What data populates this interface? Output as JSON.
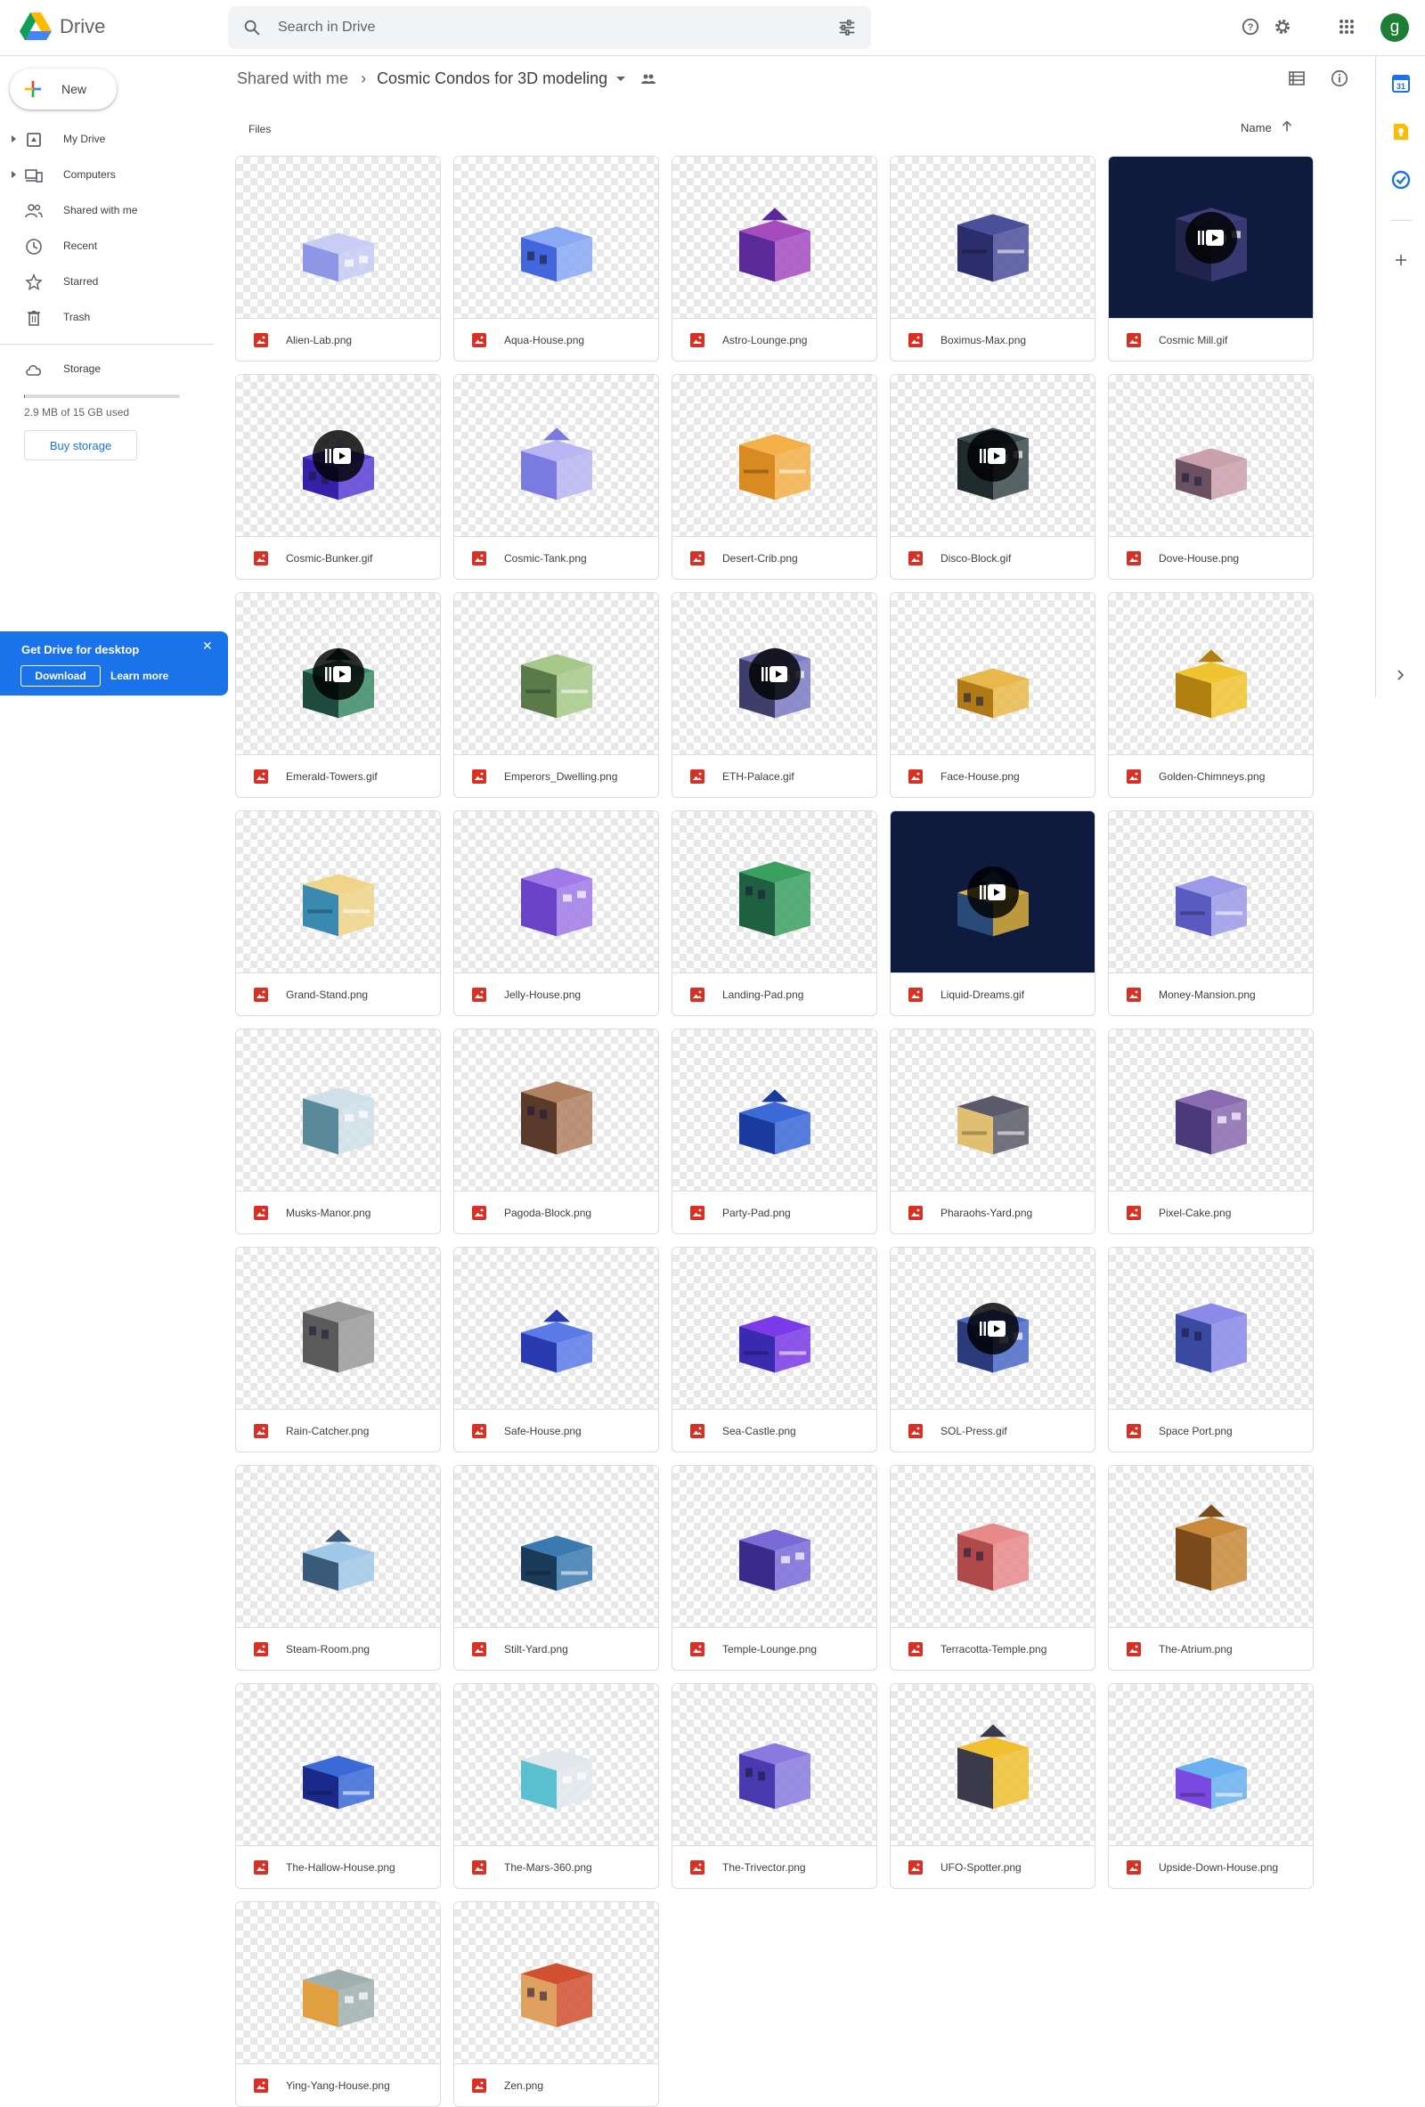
{
  "header": {
    "app_title": "Drive",
    "search_placeholder": "Search in Drive",
    "avatar_initial": "g",
    "icons": [
      "drive-logo",
      "search-icon",
      "tune-icon",
      "help-icon",
      "settings-icon",
      "apps-icon"
    ]
  },
  "sidebar": {
    "new_label": "New",
    "items": [
      {
        "label": "My Drive",
        "icon": "my-drive-icon",
        "expandable": true
      },
      {
        "label": "Computers",
        "icon": "computers-icon",
        "expandable": true
      },
      {
        "label": "Shared with me",
        "icon": "shared-icon",
        "expandable": false
      },
      {
        "label": "Recent",
        "icon": "recent-icon",
        "expandable": false
      },
      {
        "label": "Starred",
        "icon": "star-icon",
        "expandable": false
      },
      {
        "label": "Trash",
        "icon": "trash-icon",
        "expandable": false
      }
    ],
    "storage_label": "Storage",
    "storage_text": "2.9 MB of 15 GB used",
    "storage_fraction": 0.0002,
    "buy_storage_label": "Buy storage"
  },
  "promo": {
    "title": "Get Drive for desktop",
    "download_label": "Download",
    "learn_more_label": "Learn more"
  },
  "main": {
    "breadcrumb": [
      "Shared with me",
      "Cosmic Condos for 3D modeling"
    ],
    "section_label": "Files",
    "sort_label": "Name",
    "files": [
      {
        "name": "Alien-Lab.png",
        "animated": false,
        "dark_bg": false,
        "colors": [
          "#c7cdf5",
          "#8e97e6"
        ]
      },
      {
        "name": "Aqua-House.png",
        "animated": false,
        "dark_bg": false,
        "colors": [
          "#8aa9f4",
          "#4466dd"
        ]
      },
      {
        "name": "Astro-Lounge.png",
        "animated": false,
        "dark_bg": false,
        "colors": [
          "#a44bc0",
          "#5b2a9a"
        ]
      },
      {
        "name": "Boximus-Max.png",
        "animated": false,
        "dark_bg": false,
        "colors": [
          "#4a4f9a",
          "#2b2e6a"
        ]
      },
      {
        "name": "Cosmic Mill.gif",
        "animated": true,
        "dark_bg": true,
        "colors": [
          "#3e3f7a",
          "#22234a"
        ]
      },
      {
        "name": "Cosmic-Bunker.gif",
        "animated": true,
        "dark_bg": false,
        "colors": [
          "#5b3fd6",
          "#3520a8"
        ]
      },
      {
        "name": "Cosmic-Tank.png",
        "animated": false,
        "dark_bg": false,
        "colors": [
          "#b9b5f2",
          "#7b7ae0"
        ]
      },
      {
        "name": "Desert-Crib.png",
        "animated": false,
        "dark_bg": false,
        "colors": [
          "#f5b04a",
          "#d98a20"
        ]
      },
      {
        "name": "Disco-Block.gif",
        "animated": true,
        "dark_bg": false,
        "colors": [
          "#3a4a4c",
          "#1f2b2d"
        ]
      },
      {
        "name": "Dove-House.png",
        "animated": false,
        "dark_bg": false,
        "colors": [
          "#c9a0ac",
          "#6a5060"
        ]
      },
      {
        "name": "Emerald-Towers.gif",
        "animated": true,
        "dark_bg": false,
        "colors": [
          "#3b8b66",
          "#1f4a3e"
        ]
      },
      {
        "name": "Emperors_Dwelling.png",
        "animated": false,
        "dark_bg": false,
        "colors": [
          "#a6c98a",
          "#5a7a4a"
        ]
      },
      {
        "name": "ETH-Palace.gif",
        "animated": true,
        "dark_bg": false,
        "colors": [
          "#7a7ac4",
          "#3e3e6a"
        ]
      },
      {
        "name": "Face-House.png",
        "animated": false,
        "dark_bg": false,
        "colors": [
          "#e9b84a",
          "#b07a18"
        ]
      },
      {
        "name": "Golden-Chimneys.png",
        "animated": false,
        "dark_bg": false,
        "colors": [
          "#f0c430",
          "#b08010"
        ]
      },
      {
        "name": "Grand-Stand.png",
        "animated": false,
        "dark_bg": false,
        "colors": [
          "#f0d48a",
          "#3a8ab0"
        ]
      },
      {
        "name": "Jelly-House.png",
        "animated": false,
        "dark_bg": false,
        "colors": [
          "#a07ae8",
          "#6a44c8"
        ]
      },
      {
        "name": "Landing-Pad.png",
        "animated": false,
        "dark_bg": false,
        "colors": [
          "#3aa060",
          "#1e6040"
        ]
      },
      {
        "name": "Liquid-Dreams.gif",
        "animated": true,
        "dark_bg": true,
        "colors": [
          "#d8b040",
          "#2a4a7a"
        ]
      },
      {
        "name": "Money-Mansion.png",
        "animated": false,
        "dark_bg": false,
        "colors": [
          "#9a9ae8",
          "#5a5ac0"
        ]
      },
      {
        "name": "Musks-Manor.png",
        "animated": false,
        "dark_bg": false,
        "colors": [
          "#cfe0e8",
          "#5a8a9a"
        ]
      },
      {
        "name": "Pagoda-Block.png",
        "animated": false,
        "dark_bg": false,
        "colors": [
          "#b08060",
          "#5a3a2a"
        ]
      },
      {
        "name": "Party-Pad.png",
        "animated": false,
        "dark_bg": false,
        "colors": [
          "#3a6ad8",
          "#1a3aa0"
        ]
      },
      {
        "name": "Pharaohs-Yard.png",
        "animated": false,
        "dark_bg": false,
        "colors": [
          "#5a5a6a",
          "#e0c070"
        ]
      },
      {
        "name": "Pixel-Cake.png",
        "animated": false,
        "dark_bg": false,
        "colors": [
          "#8a6ab0",
          "#4a3a7a"
        ]
      },
      {
        "name": "Rain-Catcher.png",
        "animated": false,
        "dark_bg": false,
        "colors": [
          "#9a9a9a",
          "#5a5a5a"
        ]
      },
      {
        "name": "Safe-House.png",
        "animated": false,
        "dark_bg": false,
        "colors": [
          "#5a7ae8",
          "#2a3ab0"
        ]
      },
      {
        "name": "Sea-Castle.png",
        "animated": false,
        "dark_bg": false,
        "colors": [
          "#7a3ae8",
          "#3a2ab0"
        ]
      },
      {
        "name": "SOL-Press.gif",
        "animated": true,
        "dark_bg": false,
        "colors": [
          "#4a6ac8",
          "#2a3a7a"
        ]
      },
      {
        "name": "Space Port.png",
        "animated": false,
        "dark_bg": false,
        "colors": [
          "#8a8ae8",
          "#3a4aa0"
        ]
      },
      {
        "name": "Steam-Room.png",
        "animated": false,
        "dark_bg": false,
        "colors": [
          "#a0c8e8",
          "#3a5a7a"
        ]
      },
      {
        "name": "Stilt-Yard.png",
        "animated": false,
        "dark_bg": false,
        "colors": [
          "#3a7ab0",
          "#1a3a5a"
        ]
      },
      {
        "name": "Temple-Lounge.png",
        "animated": false,
        "dark_bg": false,
        "colors": [
          "#7a6ad8",
          "#3a2a8a"
        ]
      },
      {
        "name": "Terracotta-Temple.png",
        "animated": false,
        "dark_bg": false,
        "colors": [
          "#e88a8a",
          "#b04a4a"
        ]
      },
      {
        "name": "The-Atrium.png",
        "animated": false,
        "dark_bg": false,
        "colors": [
          "#c88a3a",
          "#7a4a1a"
        ]
      },
      {
        "name": "The-Hallow-House.png",
        "animated": false,
        "dark_bg": false,
        "colors": [
          "#3a6ad8",
          "#1a2a8a"
        ]
      },
      {
        "name": "The-Mars-360.png",
        "animated": false,
        "dark_bg": false,
        "colors": [
          "#e0e8ec",
          "#5ac0d0"
        ]
      },
      {
        "name": "The-Trivector.png",
        "animated": false,
        "dark_bg": false,
        "colors": [
          "#8a7ae0",
          "#4a3ab0"
        ]
      },
      {
        "name": "UFO-Spotter.png",
        "animated": false,
        "dark_bg": false,
        "colors": [
          "#f0c030",
          "#3a3a4a"
        ]
      },
      {
        "name": "Upside-Down-House.png",
        "animated": false,
        "dark_bg": false,
        "colors": [
          "#6ab0f0",
          "#7a4ae0"
        ]
      },
      {
        "name": "Ying-Yang-House.png",
        "animated": false,
        "dark_bg": false,
        "colors": [
          "#a0b0b0",
          "#e0a040"
        ]
      },
      {
        "name": "Zen.png",
        "animated": false,
        "dark_bg": false,
        "colors": [
          "#d05030",
          "#e0a060"
        ]
      }
    ]
  },
  "right_rail": {
    "icons": [
      "calendar-icon",
      "keep-icon",
      "tasks-icon",
      "add-icon",
      "expand-panel-icon"
    ]
  }
}
